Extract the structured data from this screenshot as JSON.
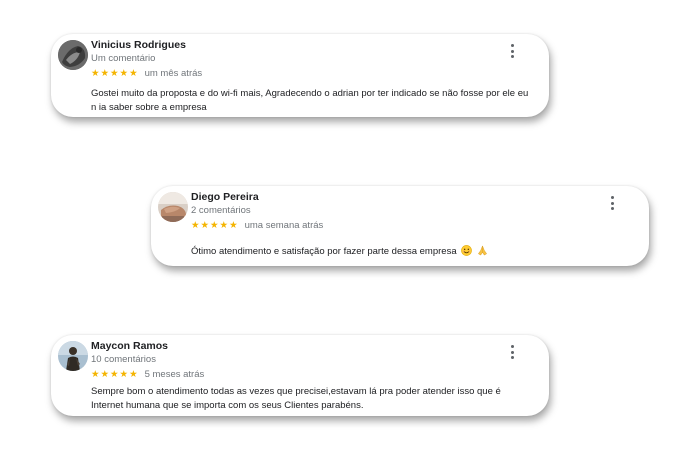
{
  "reviews": [
    {
      "name": "Vinicius Rodrigues",
      "count": "Um comentário",
      "stars": "★★★★★",
      "date": "um mês atrás",
      "text": "Gostei muito da proposta e do wi-fi mais, Agradecendo o adrian por ter indicado se não fosse por ele eu n ia saber sobre a empresa",
      "avatar_icon": "profile-photo-dark"
    },
    {
      "name": "Diego Pereira",
      "count": "2 comentários",
      "stars": "★★★★★",
      "date": "uma semana atrás",
      "text": "Ótimo atendimento e satisfação por fazer parte dessa empresa",
      "emojis": [
        "smiling-face-icon",
        "folded-hands-icon"
      ],
      "avatar_icon": "profile-photo-hand"
    },
    {
      "name": "Maycon Ramos",
      "count": "10 comentários",
      "stars": "★★★★★",
      "date": "5 meses atrás",
      "text": "Sempre bom o atendimento todas as vezes que precisei,estavam lá pra poder atender isso que é Internet humana que se importa com os seus Clientes parabéns.",
      "avatar_icon": "profile-photo-person"
    }
  ],
  "colors": {
    "star": "#f4b400",
    "name": "#202124",
    "meta": "#70757a",
    "menu_dots": "#5f6368"
  }
}
